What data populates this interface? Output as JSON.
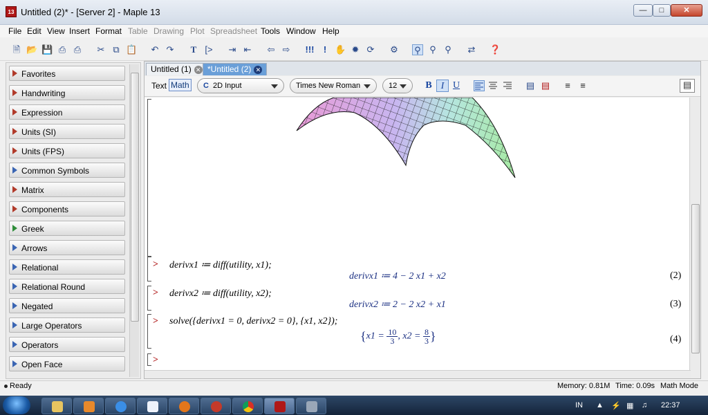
{
  "window": {
    "title": "Untitled (2)* - [Server 2] - Maple 13",
    "logo_text": "13"
  },
  "menu": [
    "File",
    "Edit",
    "View",
    "Insert",
    "Format",
    "Table",
    "Drawing",
    "Plot",
    "Spreadsheet",
    "Tools",
    "Window",
    "Help"
  ],
  "palettes": [
    "Favorites",
    "Handwriting",
    "Expression",
    "Units (SI)",
    "Units (FPS)",
    "Common Symbols",
    "Matrix",
    "Components",
    "Greek",
    "Arrows",
    "Relational",
    "Relational Round",
    "Negated",
    "Large Operators",
    "Operators",
    "Open Face"
  ],
  "tabs": [
    {
      "label": "Untitled (1)"
    },
    {
      "label": "*Untitled (2)"
    }
  ],
  "context_bar": {
    "text_label": "Text",
    "math_label": "Math",
    "input_mode": "2D Input",
    "font": "Times New Roman",
    "size": "12",
    "bold": "B",
    "italic": "I",
    "underline": "U"
  },
  "worksheet": {
    "commands": [
      {
        "prompt": ">",
        "input": "derivx1 ≔ diff(utility, x1);",
        "output": "derivx1 ≔ 4 − 2 x1 + x2",
        "label": "(2)"
      },
      {
        "prompt": ">",
        "input": "derivx2 ≔ diff(utility, x2);",
        "output": "derivx2 ≔ 2 − 2 x2 + x1",
        "label": "(3)"
      },
      {
        "prompt": ">",
        "input": "solve({derivx1 = 0, derivx2 = 0}, {x1, x2});",
        "output_prefix": "x1 = ",
        "frac1_num": "10",
        "frac1_den": "3",
        "output_mid": ", x2 = ",
        "frac2_num": "8",
        "frac2_den": "3",
        "label": "(4)"
      }
    ],
    "empty_prompt": ">"
  },
  "status": {
    "ready": "Ready",
    "memory": "Memory: 0.81M",
    "time": "Time: 0.09s",
    "mode": "Math Mode"
  },
  "taskbar": {
    "lang": "IN",
    "clock": "22:37"
  },
  "colors": {
    "prompt": "#b01818",
    "output": "#1a2f82",
    "active_tab": "#6a9fd8"
  }
}
